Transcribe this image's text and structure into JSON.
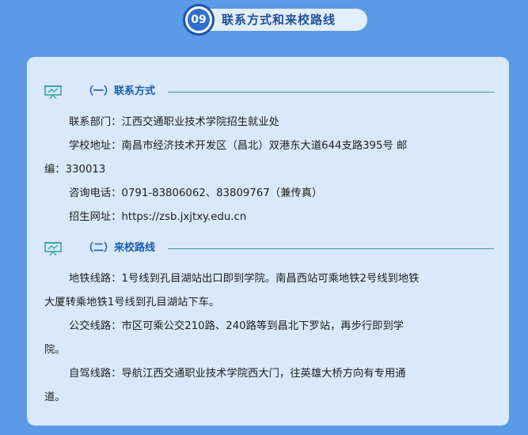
{
  "header": {
    "number": "09",
    "title": "联系方式和来校路线"
  },
  "contact": {
    "title": "（一）联系方式",
    "department": "联系部门：江西交通职业技术学院招生就业处",
    "address_line1": "学校地址：南昌市经济技术开发区（昌北）双港东大道644支路395号  邮",
    "address_line2": "编：330013",
    "phone": "咨询电话：0791-83806062、83809767（兼传真）",
    "website": "招生网址：https://zsb.jxjtxy.edu.cn"
  },
  "routes": {
    "title": "（二）来校路线",
    "metro_line1": "地铁线路：1号线到孔目湖站出口即到学院。南昌西站可乘地铁2号线到地铁",
    "metro_line2": "大厦转乘地铁1号线到孔目湖站下车。",
    "bus_line1": "公交线路：市区可乘公交210路、240路等到昌北下罗站，再步行即到学",
    "bus_line2": "院。",
    "drive_line1": "自驾线路：导航江西交通职业技术学院西大门，往英雄大桥方向有专用通",
    "drive_line2": "道。"
  },
  "colors": {
    "background": "#5b9ae6",
    "card": "#d9e8fa",
    "accent": "#1a5fb0",
    "rule": "#3b9a9a"
  },
  "icons": {
    "header": "number-badge",
    "section": "presentation-board-icon"
  }
}
